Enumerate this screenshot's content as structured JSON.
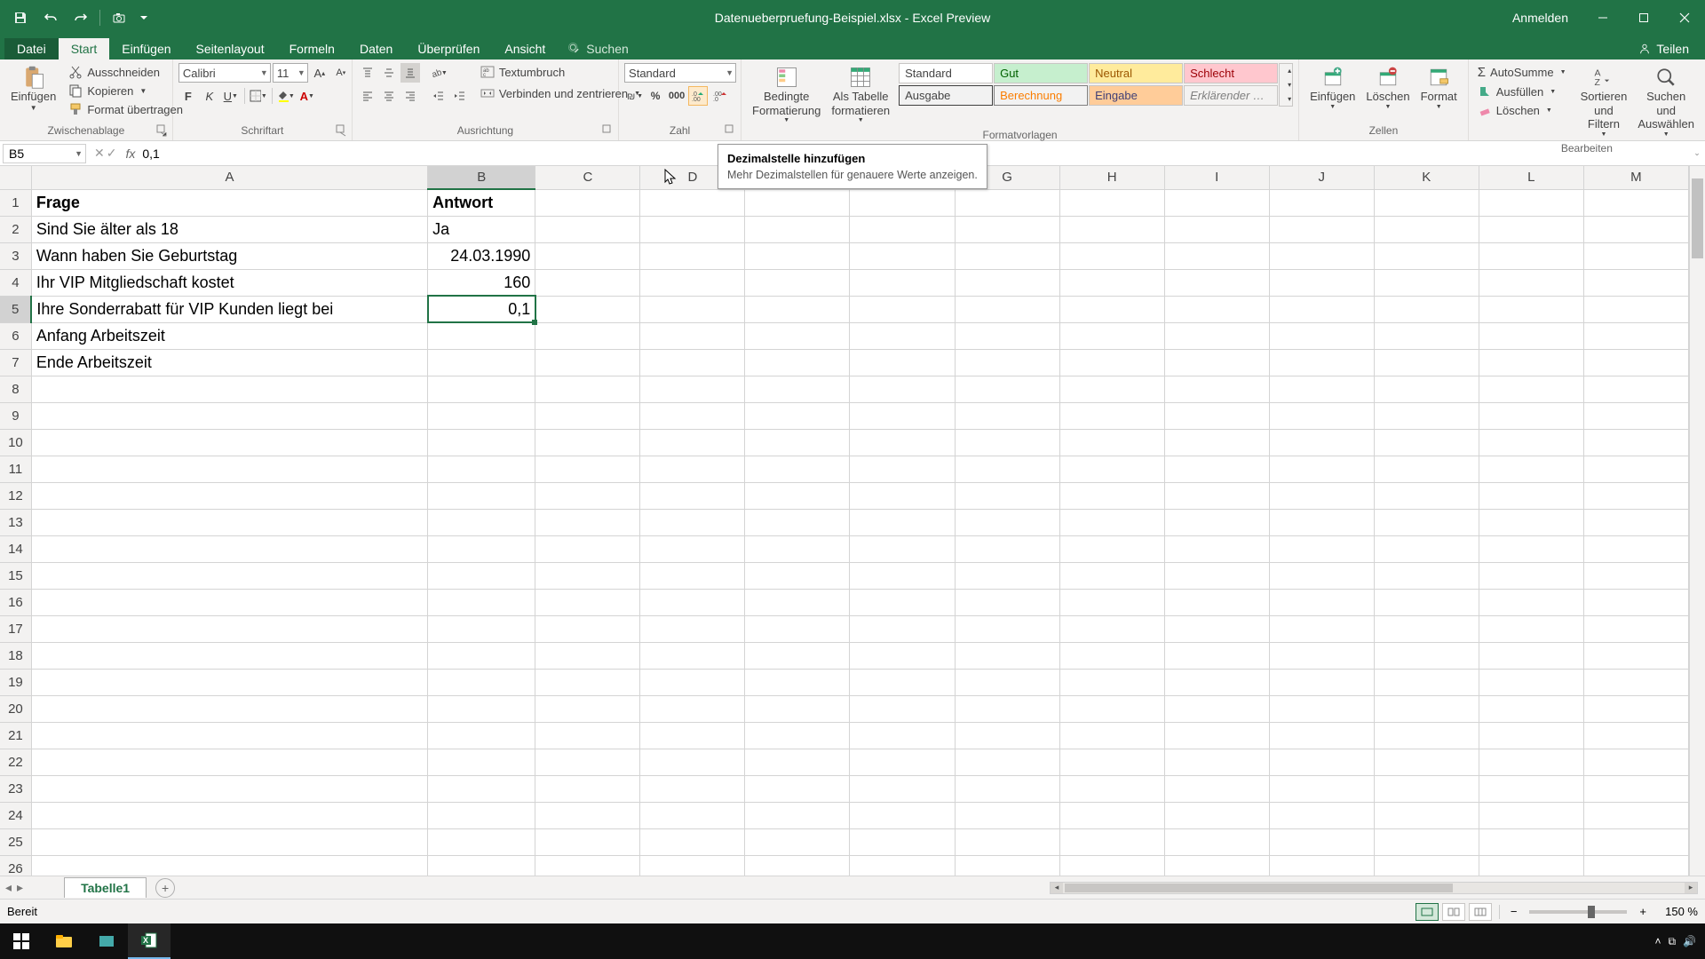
{
  "title": "Datenueberpruefung-Beispiel.xlsx - Excel Preview",
  "signin": "Anmelden",
  "menu": {
    "file": "Datei",
    "tabs": [
      "Start",
      "Einfügen",
      "Seitenlayout",
      "Formeln",
      "Daten",
      "Überprüfen",
      "Ansicht"
    ],
    "search": "Suchen",
    "share": "Teilen"
  },
  "ribbon": {
    "clipboard": {
      "paste": "Einfügen",
      "cut": "Ausschneiden",
      "copy": "Kopieren",
      "painter": "Format übertragen",
      "label": "Zwischenablage"
    },
    "font": {
      "name": "Calibri",
      "size": "11",
      "label": "Schriftart"
    },
    "align": {
      "wrap": "Textumbruch",
      "merge": "Verbinden und zentrieren",
      "label": "Ausrichtung"
    },
    "number": {
      "format": "Standard",
      "label": "Zahl"
    },
    "styles": {
      "cond": "Bedingte\nFormatierung",
      "table": "Als Tabelle\nformatieren",
      "label": "Formatvorlagen",
      "cells": [
        "Standard",
        "Gut",
        "Neutral",
        "Schlecht",
        "Ausgabe",
        "Berechnung",
        "Eingabe",
        "Erklärender …"
      ]
    },
    "cells_grp": {
      "insert": "Einfügen",
      "delete": "Löschen",
      "format": "Format",
      "label": "Zellen"
    },
    "editing": {
      "sum": "AutoSumme",
      "fill": "Ausfüllen",
      "clear": "Löschen",
      "sort": "Sortieren und\nFiltern",
      "find": "Suchen und\nAuswählen",
      "label": "Bearbeiten"
    }
  },
  "tooltip": {
    "title": "Dezimalstelle hinzufügen",
    "body": "Mehr Dezimalstellen für genauere Werte anzeigen."
  },
  "cellref": "B5",
  "formula": "0,1",
  "cols": {
    "A": 450,
    "B": 122,
    "C": 122,
    "D": 122,
    "E": 122,
    "F": 122,
    "G": 122,
    "H": 122,
    "I": 122,
    "J": 122,
    "K": 122,
    "L": 122,
    "M": 122
  },
  "rows": [
    {
      "n": 1,
      "A": "Frage",
      "B": "Antwort",
      "bold": true
    },
    {
      "n": 2,
      "A": "Sind Sie älter als 18",
      "B": "Ja"
    },
    {
      "n": 3,
      "A": "Wann haben Sie Geburtstag",
      "B": "24.03.1990",
      "br": true
    },
    {
      "n": 4,
      "A": "Ihr VIP Mitgliedschaft kostet",
      "B": "160",
      "br": true
    },
    {
      "n": 5,
      "A": "Ihre Sonderrabatt für VIP Kunden liegt bei",
      "B": "0,1",
      "br": true,
      "active": true
    },
    {
      "n": 6,
      "A": "Anfang Arbeitszeit"
    },
    {
      "n": 7,
      "A": "Ende Arbeitszeit"
    },
    {
      "n": 8
    },
    {
      "n": 9
    },
    {
      "n": 10
    },
    {
      "n": 11
    },
    {
      "n": 12
    },
    {
      "n": 13
    },
    {
      "n": 14
    },
    {
      "n": 15
    },
    {
      "n": 16
    },
    {
      "n": 17
    },
    {
      "n": 18
    },
    {
      "n": 19
    },
    {
      "n": 20
    },
    {
      "n": 21
    },
    {
      "n": 22
    },
    {
      "n": 23
    },
    {
      "n": 24
    },
    {
      "n": 25
    },
    {
      "n": 26
    }
  ],
  "sheet_tab": "Tabelle1",
  "status": "Bereit",
  "zoom": "150 %"
}
